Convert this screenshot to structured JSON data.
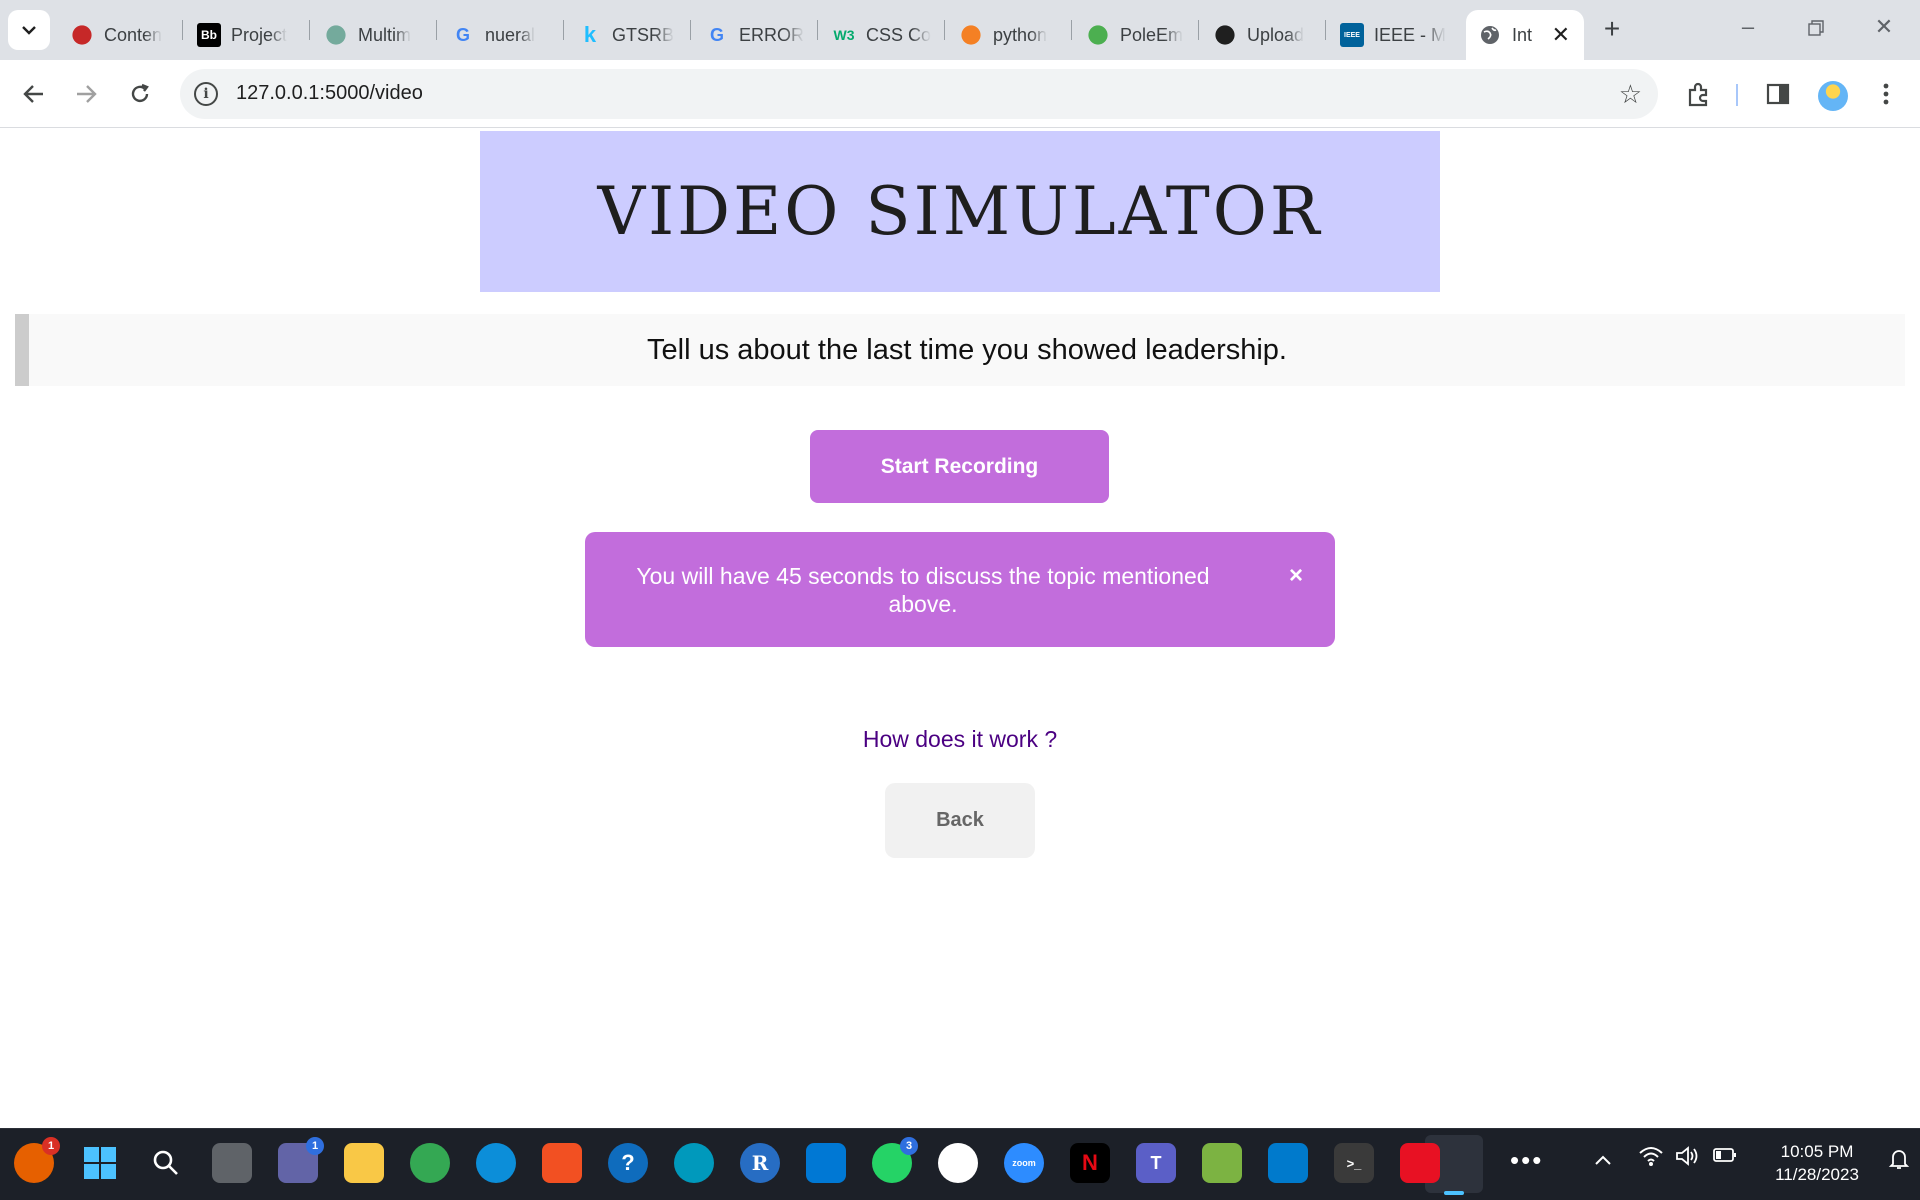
{
  "browser": {
    "tabs": [
      {
        "title": "Conten",
        "favicon": "bar-chart-icon",
        "color": "#c62828"
      },
      {
        "title": "Project",
        "favicon": "Bb",
        "color": "#000000"
      },
      {
        "title": "Multim",
        "favicon": "chatgpt-icon",
        "color": "#74aa9c"
      },
      {
        "title": "nueral",
        "favicon": "G",
        "color": "#4285f4"
      },
      {
        "title": "GTSRB",
        "favicon": "k",
        "color": "#20beff"
      },
      {
        "title": "ERROR",
        "favicon": "G",
        "color": "#4285f4"
      },
      {
        "title": "CSS Co",
        "favicon": "W3",
        "color": "#04aa6d"
      },
      {
        "title": "python",
        "favicon": "stackoverflow-icon",
        "color": "#f48024"
      },
      {
        "title": "PoleEm",
        "favicon": "leaf-icon",
        "color": "#4caf50"
      },
      {
        "title": "Upload",
        "favicon": "github-icon",
        "color": "#1f1f1f"
      },
      {
        "title": "IEEE - M",
        "favicon": "IEEE",
        "color": "#00629b"
      }
    ],
    "active_tab": {
      "title": "Int",
      "favicon": "globe-icon"
    },
    "new_tab_label": "+",
    "url": "127.0.0.1:5000/video"
  },
  "page": {
    "banner_title": "VIDEO SIMULATOR",
    "question": "Tell us about the last time you showed leadership.",
    "start_button": "Start Recording",
    "alert_message": "You will have 45 seconds to discuss the topic mentioned above.",
    "alert_close": "×",
    "how_link": "How does it work ?",
    "back_button": "Back",
    "colors": {
      "banner_bg": "#ccccff",
      "accent": "#c26ddc",
      "link": "#4b0082"
    }
  },
  "taskbar": {
    "apps": [
      {
        "name": "firefox-icon",
        "glyph": "",
        "bg": "#e66000",
        "badge": "1"
      },
      {
        "name": "windows-start-icon",
        "glyph": "",
        "bg": "#1a73e8",
        "badge": ""
      },
      {
        "name": "search-icon",
        "glyph": "",
        "bg": "transparent",
        "badge": ""
      },
      {
        "name": "task-view-icon",
        "glyph": "",
        "bg": "#5f6368",
        "badge": ""
      },
      {
        "name": "teams-chat-icon",
        "glyph": "",
        "bg": "#6264a7",
        "badge": "1"
      },
      {
        "name": "file-explorer-icon",
        "glyph": "",
        "bg": "#f9c846",
        "badge": ""
      },
      {
        "name": "chrome-icon",
        "glyph": "",
        "bg": "#34a853",
        "badge": ""
      },
      {
        "name": "edge-icon",
        "glyph": "",
        "bg": "#0c8ed9",
        "badge": ""
      },
      {
        "name": "microsoft-store-icon",
        "glyph": "",
        "bg": "#f25022",
        "badge": ""
      },
      {
        "name": "get-help-icon",
        "glyph": "?",
        "bg": "#0f6cbd",
        "badge": ""
      },
      {
        "name": "cortana-icon",
        "glyph": "",
        "bg": "#0099bc",
        "badge": ""
      },
      {
        "name": "r-icon",
        "glyph": "R",
        "bg": "#276dc3",
        "badge": ""
      },
      {
        "name": "mail-icon",
        "glyph": "",
        "bg": "#0078d4",
        "badge": ""
      },
      {
        "name": "whatsapp-icon",
        "glyph": "",
        "bg": "#25d366",
        "badge": "3"
      },
      {
        "name": "mongodb-icon",
        "glyph": "",
        "bg": "#ffffff",
        "badge": ""
      },
      {
        "name": "zoom-icon",
        "glyph": "zoom",
        "bg": "#2d8cff",
        "badge": ""
      },
      {
        "name": "netflix-icon",
        "glyph": "N",
        "bg": "#000000",
        "badge": ""
      },
      {
        "name": "teams-icon",
        "glyph": "T",
        "bg": "#5b5fc7",
        "badge": ""
      },
      {
        "name": "notepad-icon",
        "glyph": "",
        "bg": "#7cb342",
        "badge": ""
      },
      {
        "name": "vscode-icon",
        "glyph": "",
        "bg": "#007acc",
        "badge": ""
      },
      {
        "name": "terminal-icon",
        "glyph": ">_",
        "bg": "#3a3a3a",
        "badge": ""
      },
      {
        "name": "snipping-tool-icon",
        "glyph": "",
        "bg": "#e81123",
        "badge": ""
      }
    ],
    "overflow": "•••",
    "time": "10:05 PM",
    "date": "11/28/2023"
  }
}
